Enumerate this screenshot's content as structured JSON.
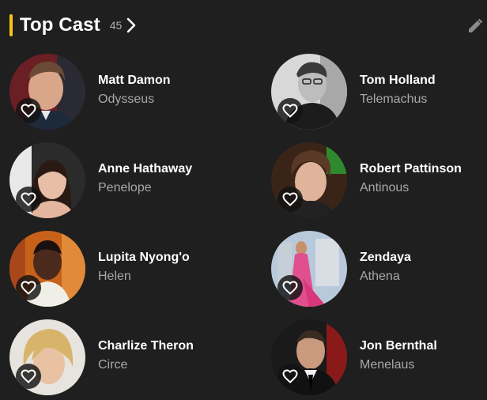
{
  "section": {
    "title": "Top Cast",
    "count": "45",
    "accent_color": "#f5c518",
    "icons": {
      "more": "chevron-right-icon",
      "edit": "pencil-icon",
      "favorite": "heart-outline-icon"
    }
  },
  "cast": [
    {
      "name": "Matt Damon",
      "role": "Odysseus"
    },
    {
      "name": "Tom Holland",
      "role": "Telemachus"
    },
    {
      "name": "Anne Hathaway",
      "role": "Penelope"
    },
    {
      "name": "Robert Pattinson",
      "role": "Antinous"
    },
    {
      "name": "Lupita Nyong'o",
      "role": "Helen"
    },
    {
      "name": "Zendaya",
      "role": "Athena"
    },
    {
      "name": "Charlize Theron",
      "role": "Circe"
    },
    {
      "name": "Jon Bernthal",
      "role": "Menelaus"
    }
  ]
}
